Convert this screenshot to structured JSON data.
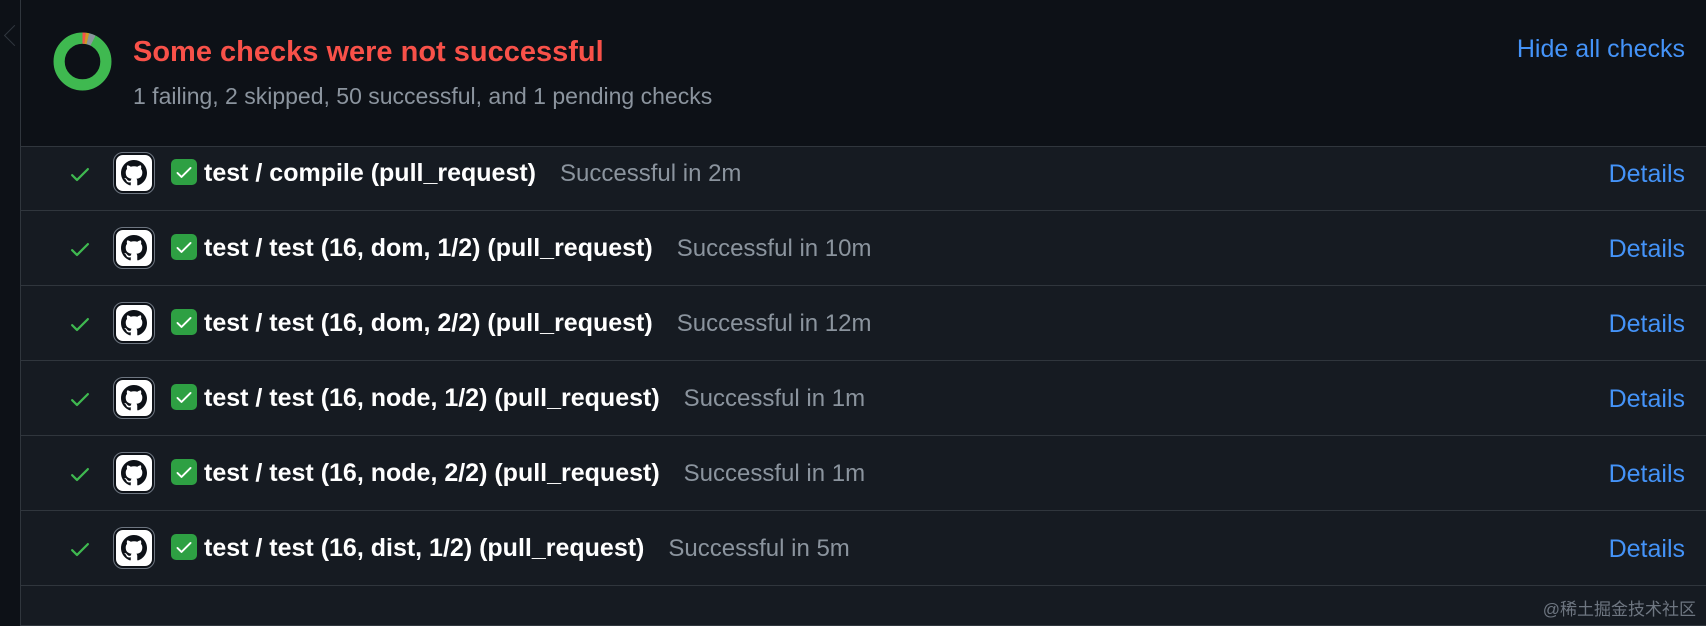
{
  "header": {
    "title": "Some checks were not successful",
    "summary": "1 failing, 2 skipped, 50 successful, and 1 pending checks",
    "hide_all_label": "Hide all checks",
    "donut": {
      "failing": 1,
      "skipped": 2,
      "successful": 50,
      "pending": 1
    }
  },
  "colors": {
    "failing": "#f85149",
    "success": "#3fb950",
    "pending": "#d29922",
    "skipped": "#8b949e",
    "link": "#4493f8"
  },
  "checks": [
    {
      "name": "test / compile (pull_request)",
      "status": "Successful in 2m",
      "details": "Details",
      "icon": "check-icon"
    },
    {
      "name": "test / test (16, dom, 1/2) (pull_request)",
      "status": "Successful in 10m",
      "details": "Details",
      "icon": "check-icon"
    },
    {
      "name": "test / test (16, dom, 2/2) (pull_request)",
      "status": "Successful in 12m",
      "details": "Details",
      "icon": "check-icon"
    },
    {
      "name": "test / test (16, node, 1/2) (pull_request)",
      "status": "Successful in 1m",
      "details": "Details",
      "icon": "check-icon"
    },
    {
      "name": "test / test (16, node, 2/2) (pull_request)",
      "status": "Successful in 1m",
      "details": "Details",
      "icon": "check-icon"
    },
    {
      "name": "test / test (16, dist, 1/2) (pull_request)",
      "status": "Successful in 5m",
      "details": "Details",
      "icon": "check-icon"
    }
  ],
  "watermark": "@稀土掘金技术社区"
}
